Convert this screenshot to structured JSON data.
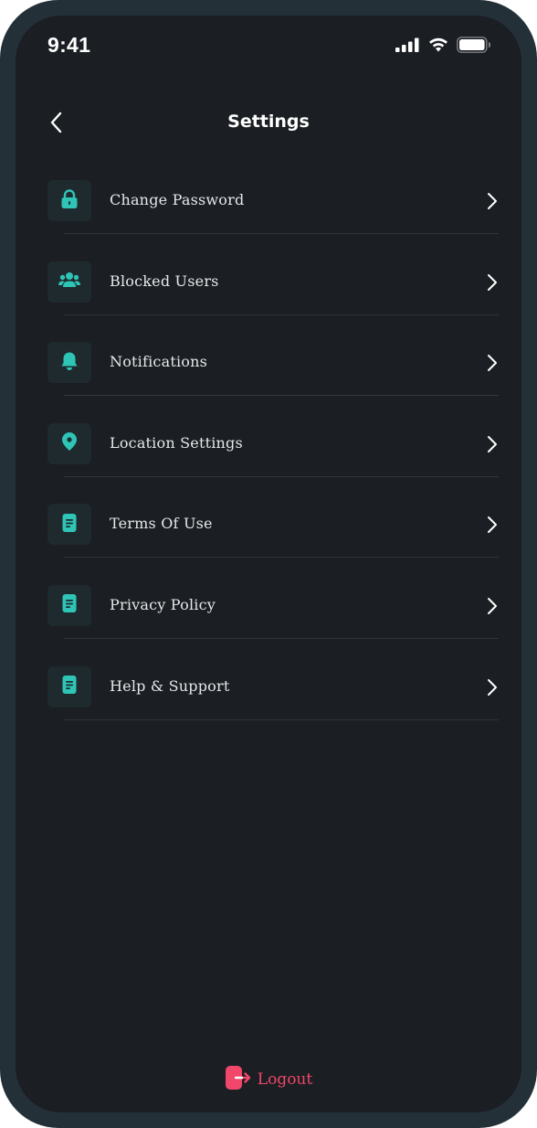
{
  "status_bar": {
    "time": "9:41"
  },
  "header": {
    "title": "Settings"
  },
  "settings": [
    {
      "icon": "lock-icon",
      "label": "Change Password"
    },
    {
      "icon": "users-icon",
      "label": "Blocked Users"
    },
    {
      "icon": "bell-icon",
      "label": "Notifications"
    },
    {
      "icon": "location-pin-icon",
      "label": "Location Settings"
    },
    {
      "icon": "document-icon",
      "label": "Terms Of Use"
    },
    {
      "icon": "document-icon",
      "label": "Privacy Policy"
    },
    {
      "icon": "document-icon",
      "label": "Help & Support"
    }
  ],
  "logout": {
    "label": "Logout",
    "icon": "logout-icon"
  },
  "colors": {
    "background": "#1b1e22",
    "accent": "#2ec4b6",
    "icon_tile": "#1f2a2e",
    "danger": "#f0476b"
  }
}
